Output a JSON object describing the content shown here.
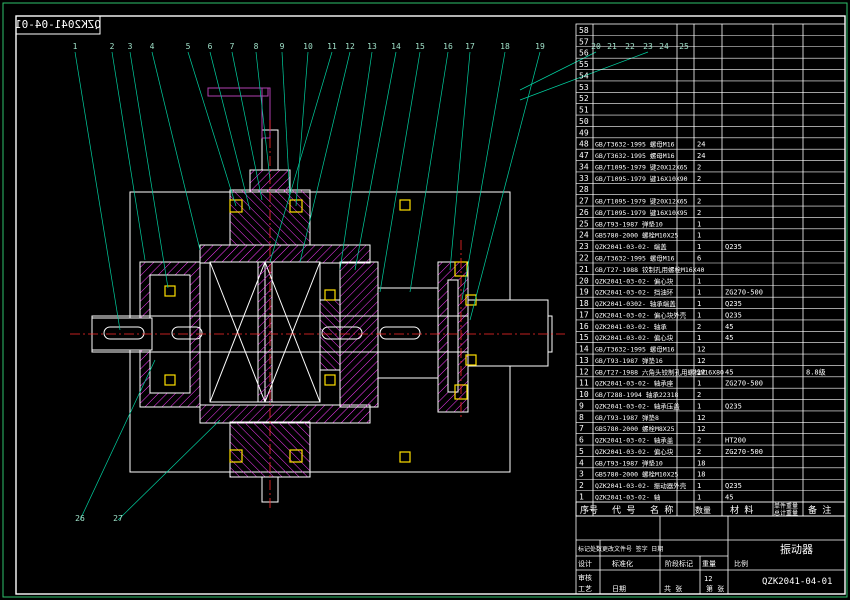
{
  "drawing_code_mirrored": "QZK2041-04-01",
  "title_block": {
    "drawing_name": "振动器",
    "drawing_code": "QZK2041-04-01",
    "scale_label": "比例",
    "weight_label": "重量",
    "stage_label": "阶段标记",
    "sheet_count": "共 张",
    "sheet_no": "第 张",
    "row1": "标记处数更改文件号 签字 日期",
    "designer": "设计",
    "standardize": "标准化",
    "review": "审核",
    "process": "工艺",
    "date_label": "日期",
    "sheet_num_val": "12",
    "count_val": "1"
  },
  "bom_header": {
    "seq": "序号",
    "code": "代 号",
    "name": "名 称",
    "qty": "数量",
    "material": "材 料",
    "unit_weight": "单件重量",
    "total_weight": "总计重量",
    "remark": "备 注"
  },
  "bom_rows": [
    {
      "no": "58",
      "code": "",
      "qty": "",
      "mat": "",
      "rem": ""
    },
    {
      "no": "57",
      "code": "",
      "qty": "",
      "mat": "",
      "rem": ""
    },
    {
      "no": "56",
      "code": "",
      "qty": "",
      "mat": "",
      "rem": ""
    },
    {
      "no": "55",
      "code": "",
      "qty": "",
      "mat": "",
      "rem": ""
    },
    {
      "no": "54",
      "code": "",
      "qty": "",
      "mat": "",
      "rem": ""
    },
    {
      "no": "53",
      "code": "",
      "qty": "",
      "mat": "",
      "rem": ""
    },
    {
      "no": "52",
      "code": "",
      "qty": "",
      "mat": "",
      "rem": ""
    },
    {
      "no": "51",
      "code": "",
      "qty": "",
      "mat": "",
      "rem": ""
    },
    {
      "no": "50",
      "code": "",
      "qty": "",
      "mat": "",
      "rem": ""
    },
    {
      "no": "49",
      "code": "",
      "qty": "",
      "mat": "",
      "rem": ""
    },
    {
      "no": "48",
      "code": "GB/T3632-1995 螺母M16",
      "qty": "24",
      "mat": "",
      "rem": ""
    },
    {
      "no": "47",
      "code": "GB/T3632-1995 螺母M16",
      "qty": "24",
      "mat": "",
      "rem": ""
    },
    {
      "no": "34",
      "code": "GB/T1095-1979 键20X12X65",
      "qty": "2",
      "mat": "",
      "rem": ""
    },
    {
      "no": "33",
      "code": "GB/T1095-1979 键16X10X90",
      "qty": "2",
      "mat": "",
      "rem": ""
    },
    {
      "no": "28",
      "code": "",
      "qty": "",
      "mat": "",
      "rem": ""
    },
    {
      "no": "27",
      "code": "GB/T1095-1979 键20X12X65",
      "qty": "2",
      "mat": "",
      "rem": ""
    },
    {
      "no": "26",
      "code": "GB/T1095-1979 键16X10X95",
      "qty": "2",
      "mat": "",
      "rem": ""
    },
    {
      "no": "25",
      "code": "GB/T93-1987 弹垫10",
      "qty": "1",
      "mat": "",
      "rem": ""
    },
    {
      "no": "24",
      "code": "GB5780-2000 螺栓M10X25",
      "qty": "1",
      "mat": "",
      "rem": ""
    },
    {
      "no": "23",
      "code": "QZK2041-03-02- 端盖",
      "qty": "1",
      "mat": "Q235",
      "rem": ""
    },
    {
      "no": "22",
      "code": "GB/T3632-1995 螺母M16",
      "qty": "6",
      "mat": "",
      "rem": ""
    },
    {
      "no": "21",
      "code": "GB/T27-1988 铰制孔用螺栓M16X40",
      "qty": "",
      "mat": "",
      "rem": ""
    },
    {
      "no": "20",
      "code": "QZK2041-03-02- 偏心块",
      "qty": "1",
      "mat": "",
      "rem": ""
    },
    {
      "no": "19",
      "code": "QZK2041-03-02- 挡油环",
      "qty": "1",
      "mat": "ZG270-500",
      "rem": ""
    },
    {
      "no": "18",
      "code": "QZK2041-0302- 轴承端盖",
      "qty": "1",
      "mat": "Q235",
      "rem": ""
    },
    {
      "no": "17",
      "code": "QZK2041-03-02- 偏心块外壳",
      "qty": "1",
      "mat": "Q235",
      "rem": ""
    },
    {
      "no": "16",
      "code": "QZK2041-03-02- 轴承",
      "qty": "2",
      "mat": "45",
      "rem": ""
    },
    {
      "no": "15",
      "code": "QZK2041-03-02- 偏心块",
      "qty": "1",
      "mat": "45",
      "rem": ""
    },
    {
      "no": "14",
      "code": "GB/T3632-1995 螺母M16",
      "qty": "12",
      "mat": "",
      "rem": ""
    },
    {
      "no": "13",
      "code": "GB/T93-1987 弹垫16",
      "qty": "12",
      "mat": "",
      "rem": ""
    },
    {
      "no": "12",
      "code": "GB/T27-1988 六角头铰制孔用螺栓M16X80",
      "qty": "12",
      "mat": "45",
      "rem": "8.8级"
    },
    {
      "no": "11",
      "code": "QZK2041-03-02- 轴承座",
      "qty": "1",
      "mat": "ZG270-500",
      "rem": ""
    },
    {
      "no": "10",
      "code": "GB/T288-1994 轴承22318",
      "qty": "2",
      "mat": "",
      "rem": ""
    },
    {
      "no": "9",
      "code": "QZK2041-03-02- 轴承压盖",
      "qty": "1",
      "mat": "Q235",
      "rem": ""
    },
    {
      "no": "8",
      "code": "GB/T93-1987 弹垫8",
      "qty": "12",
      "mat": "",
      "rem": ""
    },
    {
      "no": "7",
      "code": "GB5780-2000 螺栓M8X25",
      "qty": "12",
      "mat": "",
      "rem": ""
    },
    {
      "no": "6",
      "code": "QZK2041-03-02- 轴承盖",
      "qty": "2",
      "mat": "HT200",
      "rem": ""
    },
    {
      "no": "5",
      "code": "QZK2041-03-02- 偏心块",
      "qty": "2",
      "mat": "ZG270-500",
      "rem": ""
    },
    {
      "no": "4",
      "code": "GB/T93-1987 弹垫10",
      "qty": "18",
      "mat": "",
      "rem": ""
    },
    {
      "no": "3",
      "code": "GB5780-2000 螺栓M10X25",
      "qty": "18",
      "mat": "",
      "rem": ""
    },
    {
      "no": "2",
      "code": "QZK2041-03-02- 振动器外壳",
      "qty": "1",
      "mat": "Q235",
      "rem": ""
    },
    {
      "no": "1",
      "code": "QZK2041-03-02- 轴",
      "qty": "1",
      "mat": "45",
      "rem": ""
    }
  ],
  "balloons_top": [
    "1",
    "2",
    "3",
    "4",
    "5",
    "6",
    "7",
    "8",
    "9",
    "10",
    "11",
    "12",
    "13",
    "14",
    "15",
    "16",
    "17",
    "18",
    "19"
  ],
  "balloons_right_top": [
    "20",
    "21",
    "22",
    "23",
    "24",
    "25"
  ],
  "balloons_bottom": [
    "26",
    "27"
  ],
  "colors": {
    "outline": "#ffffff",
    "leader": "#00d0a0",
    "hatch": "#ff3cff",
    "center": "#ff2a2a",
    "bolt": "#ffe000",
    "magenta_part": "#b040b0"
  }
}
